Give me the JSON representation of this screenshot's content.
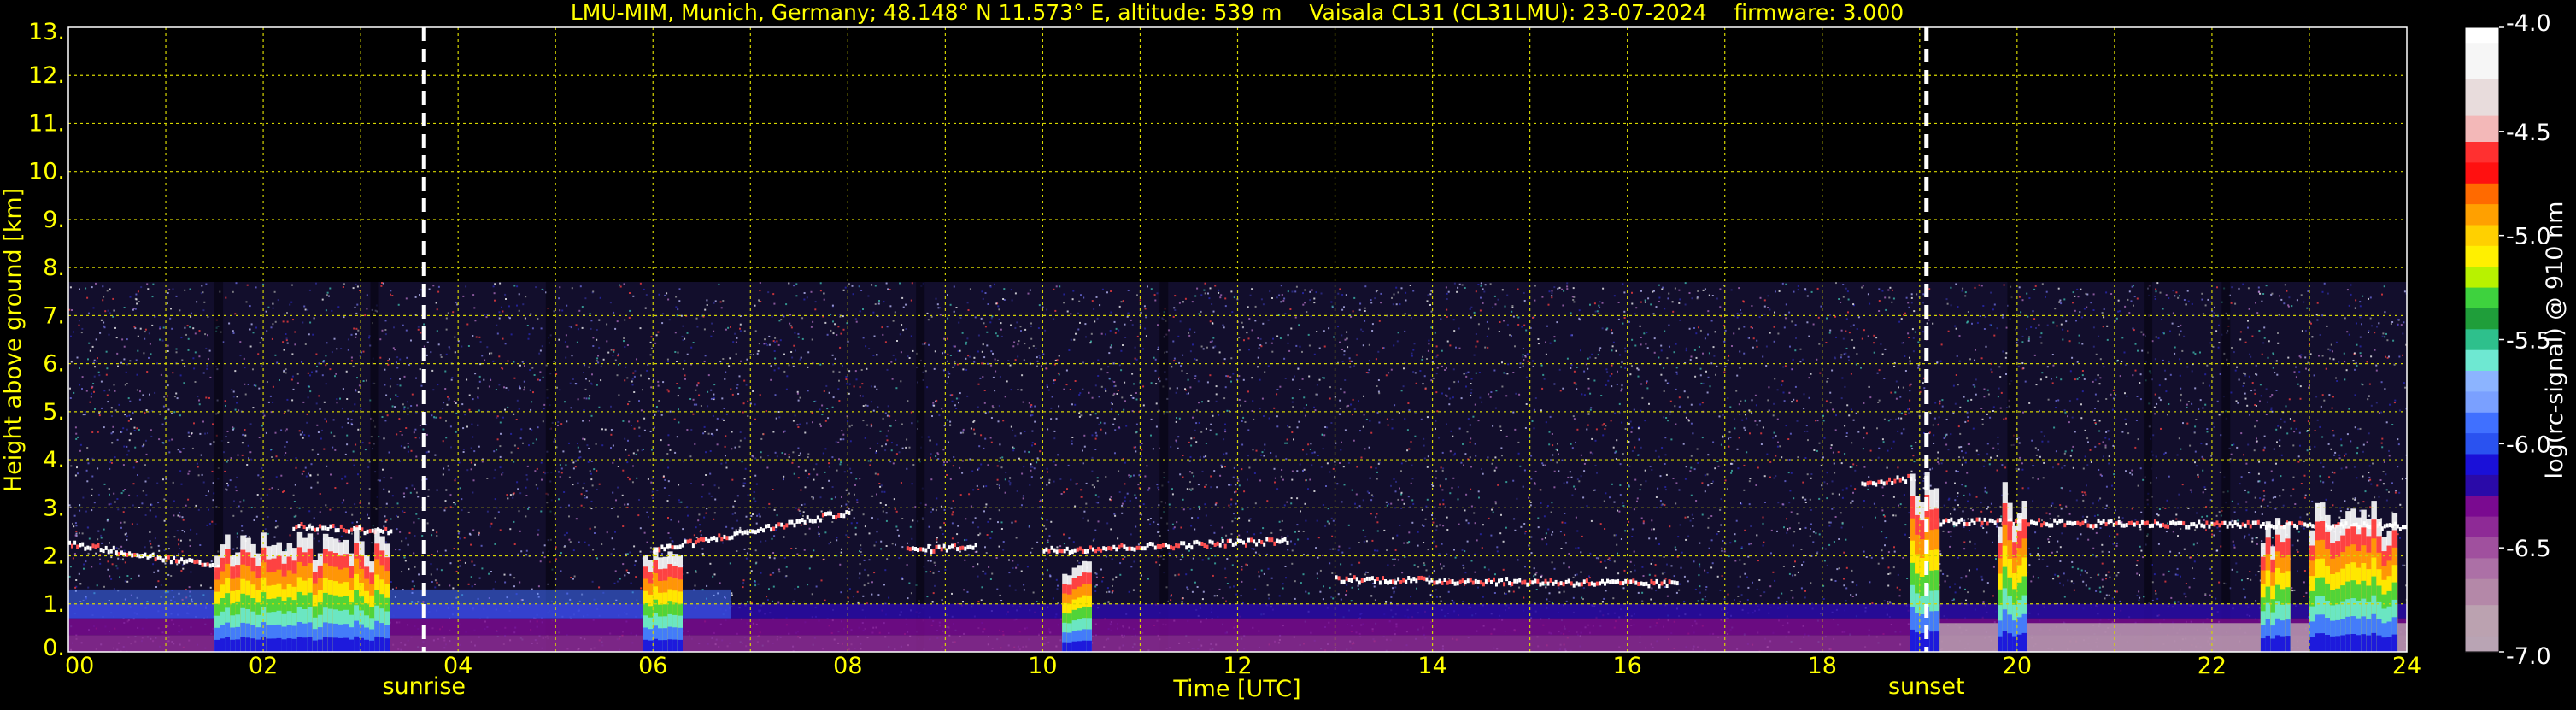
{
  "chart_data": {
    "type": "heatmap",
    "title": "LMU-MIM, Munich, Germany; 48.148° N 11.573° E, altitude: 539 m    Vaisala CL31 (CL31LMU): 23-07-2024    firmware: 3.000",
    "xlabel": "Time [UTC]",
    "ylabel": "Height above ground [km]",
    "xlim": [
      0,
      24
    ],
    "ylim": [
      0,
      13
    ],
    "x_ticks": [
      "00",
      "02",
      "04",
      "06",
      "08",
      "10",
      "12",
      "14",
      "16",
      "18",
      "20",
      "22",
      "24"
    ],
    "x_tick_values": [
      0,
      2,
      4,
      6,
      8,
      10,
      12,
      14,
      16,
      18,
      20,
      22,
      24
    ],
    "y_ticks": [
      "0.",
      "1.",
      "2.",
      "3.",
      "4.",
      "5.",
      "6.",
      "7.",
      "8.",
      "9.",
      "10.",
      "11.",
      "12.",
      "13."
    ],
    "y_tick_values": [
      0,
      1,
      2,
      3,
      4,
      5,
      6,
      7,
      8,
      9,
      10,
      11,
      12,
      13
    ],
    "grid": true,
    "grid_color": "#d6d600",
    "text_color": "#ffff00",
    "background": "#000000",
    "data_ceiling_km": 7.7,
    "events": [
      {
        "name": "sunrise",
        "time": 3.65
      },
      {
        "name": "sunset",
        "time": 19.07
      }
    ],
    "colorbar": {
      "label": "log(rc-signal) @ 910 nm",
      "range": [
        -7.0,
        -4.0
      ],
      "tick_labels": [
        "-4.0",
        "-4.5",
        "-5.0",
        "-5.5",
        "-6.0",
        "-6.5",
        "-7.0"
      ],
      "tick_values": [
        -4.0,
        -4.5,
        -5.0,
        -5.5,
        -6.0,
        -6.5,
        -7.0
      ],
      "bands": [
        {
          "value": -4.0,
          "color": "#ffffff"
        },
        {
          "value": -4.15,
          "color": "#f6f6f6"
        },
        {
          "value": -4.35,
          "color": "#e8dcdc"
        },
        {
          "value": -4.5,
          "color": "#f3b8b8"
        },
        {
          "value": -4.6,
          "color": "#ff3030"
        },
        {
          "value": -4.7,
          "color": "#ff1010"
        },
        {
          "value": -4.8,
          "color": "#ff6a00"
        },
        {
          "value": -4.9,
          "color": "#ffa000"
        },
        {
          "value": -5.0,
          "color": "#ffd000"
        },
        {
          "value": -5.1,
          "color": "#fff000"
        },
        {
          "value": -5.2,
          "color": "#b8f200"
        },
        {
          "value": -5.3,
          "color": "#3ed23e"
        },
        {
          "value": -5.4,
          "color": "#1f9e3a"
        },
        {
          "value": -5.5,
          "color": "#2ec08c"
        },
        {
          "value": -5.6,
          "color": "#6ee8d2"
        },
        {
          "value": -5.7,
          "color": "#8cb4ff"
        },
        {
          "value": -5.8,
          "color": "#7aa0ff"
        },
        {
          "value": -5.9,
          "color": "#4070ff"
        },
        {
          "value": -6.0,
          "color": "#2a52f0"
        },
        {
          "value": -6.1,
          "color": "#1a10d8"
        },
        {
          "value": -6.2,
          "color": "#2a0aa8"
        },
        {
          "value": -6.3,
          "color": "#7a0a90"
        },
        {
          "value": -6.4,
          "color": "#8e2a96"
        },
        {
          "value": -6.5,
          "color": "#a0509e"
        },
        {
          "value": -6.6,
          "color": "#ac70a6"
        },
        {
          "value": -6.7,
          "color": "#b488a8"
        },
        {
          "value": -6.85,
          "color": "#bba2b0"
        },
        {
          "value": -7.0,
          "color": "#b9a4b4"
        }
      ]
    },
    "cloud_layers": [
      {
        "t0": 0.0,
        "t1": 2.3,
        "h0": 2.25,
        "h1": 1.5
      },
      {
        "t0": 2.3,
        "t1": 3.3,
        "h0": 2.6,
        "h1": 2.5
      },
      {
        "t0": 6.0,
        "t1": 8.0,
        "h0": 2.1,
        "h1": 2.9
      },
      {
        "t0": 8.6,
        "t1": 9.3,
        "h0": 2.1,
        "h1": 2.2
      },
      {
        "t0": 10.0,
        "t1": 12.5,
        "h0": 2.1,
        "h1": 2.3
      },
      {
        "t0": 13.0,
        "t1": 16.5,
        "h0": 1.5,
        "h1": 1.4
      },
      {
        "t0": 18.4,
        "t1": 18.9,
        "h0": 3.5,
        "h1": 3.6
      },
      {
        "t0": 19.1,
        "t1": 24.0,
        "h0": 2.7,
        "h1": 2.6
      }
    ],
    "convective_columns": [
      {
        "t0": 1.5,
        "t1": 3.3,
        "top": 2.5
      },
      {
        "t0": 5.9,
        "t1": 6.3,
        "top": 2.3
      },
      {
        "t0": 10.2,
        "t1": 10.5,
        "top": 1.8
      },
      {
        "t0": 18.9,
        "t1": 19.2,
        "top": 3.6
      },
      {
        "t0": 19.8,
        "t1": 20.1,
        "top": 3.4
      },
      {
        "t0": 22.5,
        "t1": 22.8,
        "top": 2.8
      },
      {
        "t0": 23.0,
        "t1": 23.9,
        "top": 3.0
      }
    ]
  }
}
